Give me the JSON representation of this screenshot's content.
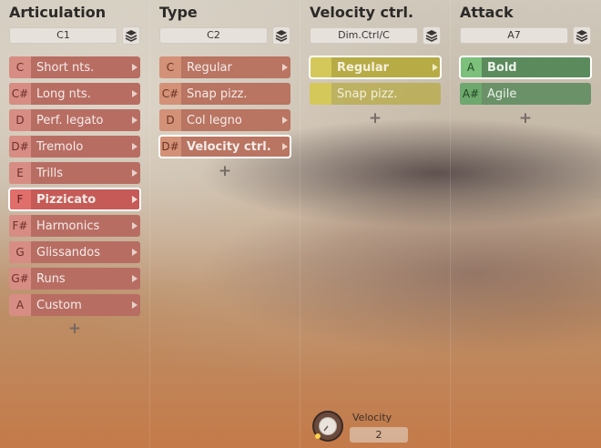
{
  "columns": [
    {
      "title": "Articulation",
      "selector": "C1",
      "slots": [
        {
          "key": "C",
          "label": "Short nts.",
          "selected": false
        },
        {
          "key": "C#",
          "label": "Long nts.",
          "selected": false
        },
        {
          "key": "D",
          "label": "Perf. legato",
          "selected": false
        },
        {
          "key": "D#",
          "label": "Tremolo",
          "selected": false
        },
        {
          "key": "E",
          "label": "Trills",
          "selected": false
        },
        {
          "key": "F",
          "label": "Pizzicato",
          "selected": true
        },
        {
          "key": "F#",
          "label": "Harmonics",
          "selected": false
        },
        {
          "key": "G",
          "label": "Glissandos",
          "selected": false
        },
        {
          "key": "G#",
          "label": "Runs",
          "selected": false
        },
        {
          "key": "A",
          "label": "Custom",
          "selected": false
        }
      ],
      "add": "+"
    },
    {
      "title": "Type",
      "selector": "C2",
      "slots": [
        {
          "key": "C",
          "label": "Regular",
          "selected": false
        },
        {
          "key": "C#",
          "label": "Snap pizz.",
          "selected": false
        },
        {
          "key": "D",
          "label": "Col legno",
          "selected": false
        },
        {
          "key": "D#",
          "label": "Velocity ctrl.",
          "selected": true
        }
      ],
      "add": "+"
    },
    {
      "title": "Velocity ctrl.",
      "selector": "Dim.Ctrl/C",
      "slots": [
        {
          "key": "",
          "label": "Regular",
          "selected": true
        },
        {
          "key": "",
          "label": "Snap pizz.",
          "selected": false
        }
      ],
      "add": "+"
    },
    {
      "title": "Attack",
      "selector": "A7",
      "slots": [
        {
          "key": "A",
          "label": "Bold",
          "selected": true
        },
        {
          "key": "A#",
          "label": "Agile",
          "selected": false
        }
      ],
      "add": "+"
    }
  ],
  "velocity": {
    "label": "Velocity",
    "value": "2"
  },
  "colors": {
    "articulation": "#b86d63",
    "type": "#b97462",
    "velocity_ctrl": "#b7ab46",
    "attack": "#5b8a5c",
    "selected_outline": "#ffffff"
  },
  "icons": {
    "stack": "layers-icon",
    "arrow": "triangle-right-icon",
    "add": "plus-icon"
  }
}
